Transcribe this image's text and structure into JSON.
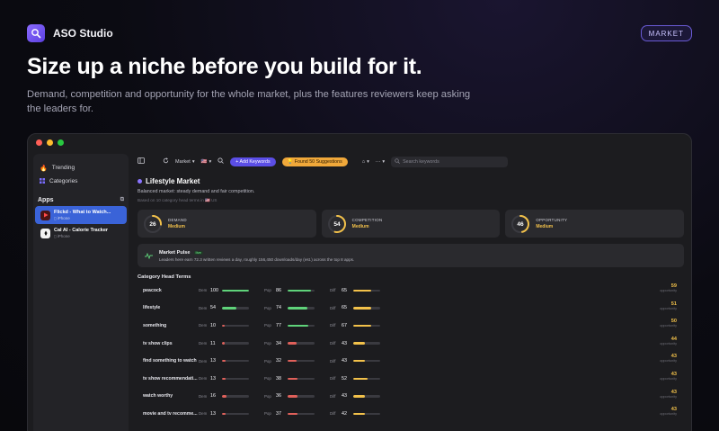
{
  "brand": {
    "name": "ASO Studio"
  },
  "tag": "MARKET",
  "headline": "Size up a niche before you build for it.",
  "subtitle": "Demand, competition and opportunity for the whole market, plus the features reviewers keep asking the leaders for.",
  "colors": {
    "accent": "#6b55f0",
    "traffic_red": "#ff5f57",
    "traffic_yellow": "#febc2e",
    "traffic_green": "#28c840",
    "ring_yellow": "#f2c14a"
  },
  "sidebar": {
    "items": [
      {
        "label": "Trending",
        "icon": "flame-icon"
      },
      {
        "label": "Categories",
        "icon": "grid-icon"
      }
    ],
    "apps_heading": "Apps",
    "apps": [
      {
        "title": "Flickd - What to Watch...",
        "platform": "iPhone",
        "active": true
      },
      {
        "title": "Cal AI - Calorie Tracker",
        "platform": "iPhone",
        "active": false
      }
    ]
  },
  "toolbar": {
    "market_label": "Market",
    "flag": "🇺🇸",
    "add_keywords": "+ Add Keywords",
    "suggestions": "Found 50 Suggestions",
    "search_placeholder": "Search keywords"
  },
  "market": {
    "title": "Lifestyle Market",
    "desc": "Balanced market: steady demand and fair competition.",
    "note": "Based on 10 category head terms in 🇺🇸 US",
    "metrics": [
      {
        "value": "26",
        "label": "DEMAND",
        "level": "Medium",
        "fraction": 0.26
      },
      {
        "value": "54",
        "label": "COMPETITION",
        "level": "Medium",
        "fraction": 0.54
      },
      {
        "value": "46",
        "label": "OPPORTUNITY",
        "level": "Medium",
        "fraction": 0.46
      }
    ],
    "pulse": {
      "title": "Market Pulse",
      "badge": "live",
      "text": "Leaders here earn 72.3 written reviews a day, roughly 156,450 downloads/day (est.) across the top 8 apps."
    },
    "terms_heading": "Category Head Terms",
    "col_labels": {
      "dem": "Dem",
      "pop": "Pop",
      "diff": "Diff",
      "opp": "opportunity"
    },
    "terms": [
      {
        "name": "peacock",
        "dem": "100",
        "pop": "86",
        "diff": "65",
        "opp": "59"
      },
      {
        "name": "lifestyle",
        "dem": "54",
        "pop": "74",
        "diff": "65",
        "opp": "51"
      },
      {
        "name": "something",
        "dem": "10",
        "pop": "77",
        "diff": "67",
        "opp": "50"
      },
      {
        "name": "tv show clips",
        "dem": "11",
        "pop": "34",
        "diff": "43",
        "opp": "44"
      },
      {
        "name": "find something to watch",
        "dem": "13",
        "pop": "32",
        "diff": "43",
        "opp": "43"
      },
      {
        "name": "tv show recommendati...",
        "dem": "13",
        "pop": "38",
        "diff": "52",
        "opp": "43"
      },
      {
        "name": "watch worthy",
        "dem": "16",
        "pop": "36",
        "diff": "43",
        "opp": "43"
      },
      {
        "name": "movie and tv recomme...",
        "dem": "13",
        "pop": "37",
        "diff": "42",
        "opp": "43"
      }
    ]
  }
}
